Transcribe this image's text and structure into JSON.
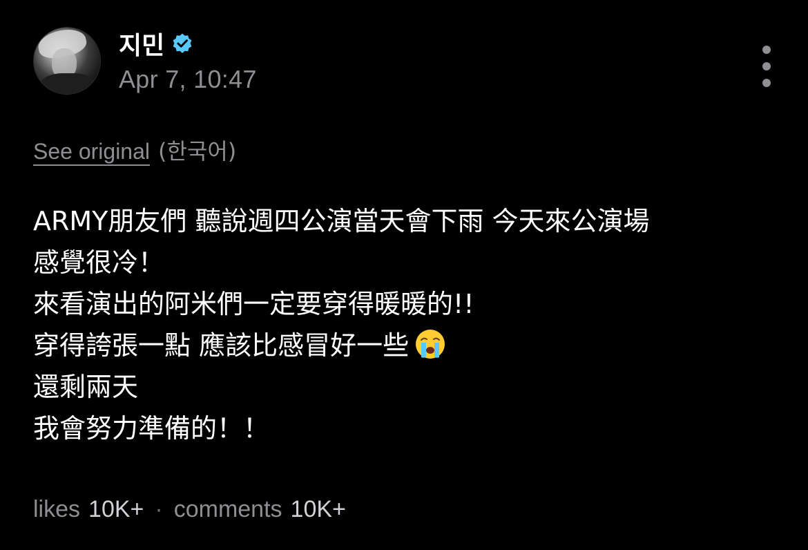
{
  "post": {
    "author": {
      "name": "지민",
      "verified_icon": "verified-badge-icon",
      "badge_color": "#5ac8fa"
    },
    "timestamp": "Apr 7, 10:47",
    "more_icon": "more-vertical-icon",
    "translation": {
      "see_original": "See original",
      "language": "(한국어)"
    },
    "body_lines": [
      "ARMY朋友們 聽說週四公演當天會下雨 今天來公演場",
      "感覺很冷！",
      "來看演出的阿米們一定要穿得暖暖的!!",
      "穿得誇張一點 應該比感冒好一些",
      "還剩兩天",
      "我會努力準備的！！"
    ],
    "emoji_icon": "crying-face-emoji",
    "stats": {
      "likes_label": "likes",
      "likes_count": "10K+",
      "separator": "·",
      "comments_label": "comments",
      "comments_count": "10K+"
    }
  },
  "colors": {
    "background": "#000000",
    "text_primary": "#ffffff",
    "text_secondary": "#8e8e93"
  }
}
